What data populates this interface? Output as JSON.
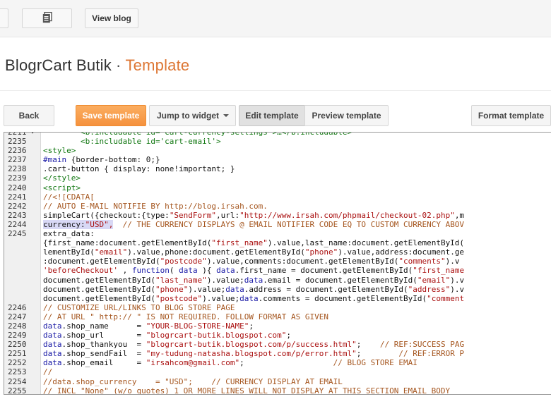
{
  "topbar": {
    "buttons": [
      {
        "name": "left-partial-button",
        "label": ""
      },
      {
        "name": "pages-button",
        "icon": "copy-document-icon",
        "label": ""
      },
      {
        "name": "view-blog-button",
        "label": "View blog"
      }
    ]
  },
  "header": {
    "blog_name": "BlogrCart Butik",
    "separator": "·",
    "section": "Template"
  },
  "actions": {
    "back": "Back",
    "save": "Save template",
    "jump": "Jump to widget",
    "edit": "Edit template",
    "preview": "Preview template",
    "format": "Format template"
  },
  "colors": {
    "accent_orange": "#dd7633",
    "save_button": "#f9a352",
    "tag_green": "#117711",
    "comment_brown": "#a5561f",
    "string_red": "#aa1111",
    "keyword_blue": "#1a1aa6"
  },
  "editor": {
    "lines": [
      {
        "n": "2211",
        "mark": "▶",
        "segs": [
          {
            "c": "c-tag",
            "t": "        <b:includable id='cart-currency-settings'>…</b:includable>"
          }
        ]
      },
      {
        "n": "2235",
        "segs": [
          {
            "c": "c-tag",
            "t": "        <b:includable id='cart-email'>"
          }
        ]
      },
      {
        "n": "2236",
        "segs": [
          {
            "c": "c-tag",
            "t": "<style>"
          }
        ]
      },
      {
        "n": "2237",
        "segs": [
          {
            "c": "c-kw",
            "t": "#main "
          },
          {
            "c": "c-plain",
            "t": "{border-bottom: 0;}"
          }
        ]
      },
      {
        "n": "2238",
        "segs": [
          {
            "c": "c-plain",
            "t": ".cart-button { display: none!important; }"
          }
        ]
      },
      {
        "n": "2239",
        "segs": [
          {
            "c": "c-tag",
            "t": "</style>"
          }
        ]
      },
      {
        "n": "2240",
        "segs": [
          {
            "c": "c-tag",
            "t": "<script>"
          }
        ]
      },
      {
        "n": "2241",
        "segs": [
          {
            "c": "c-cmt",
            "t": "//<![CDATA["
          }
        ]
      },
      {
        "n": "2242",
        "segs": [
          {
            "c": "c-cmt",
            "t": "// AUTO E-MAIL NOTIFIE BY http://blog.irsah.com."
          }
        ]
      },
      {
        "n": "2243",
        "segs": [
          {
            "c": "c-plain",
            "t": "simpleCart({checkout:{type:"
          },
          {
            "c": "c-str",
            "t": "\"SendForm\""
          },
          {
            "c": "c-plain",
            "t": ",url:"
          },
          {
            "c": "c-str",
            "t": "\"http://www.irsah.com/phpmail/checkout-02.php\""
          },
          {
            "c": "c-plain",
            "t": ",m"
          }
        ]
      },
      {
        "n": "2244",
        "segs": [
          {
            "c": "c-plain hl",
            "t": "currency:"
          },
          {
            "c": "c-str hl",
            "t": "\"USD\","
          },
          {
            "c": "c-plain",
            "t": "  "
          },
          {
            "c": "c-cmt",
            "t": "// THE CURRENCY DISPLAYS @ EMAIL NOTIFIER CODE EQ TO CUSTOM CURRENCY ABOV"
          }
        ]
      },
      {
        "n": "2245",
        "segs": [
          {
            "c": "c-plain",
            "t": "extra_data:"
          }
        ]
      },
      {
        "n": "",
        "segs": [
          {
            "c": "c-plain",
            "t": "{first_name:document.getElementById("
          },
          {
            "c": "c-str",
            "t": "\"first_name\""
          },
          {
            "c": "c-plain",
            "t": ").value,last_name:document.getElementById("
          }
        ]
      },
      {
        "n": "",
        "segs": [
          {
            "c": "c-plain",
            "t": "lementById("
          },
          {
            "c": "c-str",
            "t": "\"email\""
          },
          {
            "c": "c-plain",
            "t": ").value,phone:document.getElementById("
          },
          {
            "c": "c-str",
            "t": "\"phone\""
          },
          {
            "c": "c-plain",
            "t": ").value,address:document.ge"
          }
        ]
      },
      {
        "n": "",
        "segs": [
          {
            "c": "c-plain",
            "t": ":document.getElementById("
          },
          {
            "c": "c-str",
            "t": "\"postcode\""
          },
          {
            "c": "c-plain",
            "t": ").value,comments:document.getElementById("
          },
          {
            "c": "c-str",
            "t": "\"comments\""
          },
          {
            "c": "c-plain",
            "t": ").v"
          }
        ]
      },
      {
        "n": "",
        "segs": [
          {
            "c": "c-str",
            "t": "'beforeCheckout'"
          },
          {
            "c": "c-plain",
            "t": " , "
          },
          {
            "c": "c-kw",
            "t": "function"
          },
          {
            "c": "c-plain",
            "t": "( "
          },
          {
            "c": "c-kw",
            "t": "data"
          },
          {
            "c": "c-plain",
            "t": " ){ "
          },
          {
            "c": "c-kw",
            "t": "data"
          },
          {
            "c": "c-plain",
            "t": ".first_name = document.getElementById("
          },
          {
            "c": "c-str",
            "t": "\"first_name"
          }
        ]
      },
      {
        "n": "",
        "segs": [
          {
            "c": "c-plain",
            "t": "document.getElementById("
          },
          {
            "c": "c-str",
            "t": "\"last_name\""
          },
          {
            "c": "c-plain",
            "t": ").value;"
          },
          {
            "c": "c-kw",
            "t": "data"
          },
          {
            "c": "c-plain",
            "t": ".email = document.getElementById("
          },
          {
            "c": "c-str",
            "t": "\"email\""
          },
          {
            "c": "c-plain",
            "t": ").v"
          }
        ]
      },
      {
        "n": "",
        "segs": [
          {
            "c": "c-plain",
            "t": "document.getElementById("
          },
          {
            "c": "c-str",
            "t": "\"phone\""
          },
          {
            "c": "c-plain",
            "t": ").value;"
          },
          {
            "c": "c-kw",
            "t": "data"
          },
          {
            "c": "c-plain",
            "t": ".address = document.getElementById("
          },
          {
            "c": "c-str",
            "t": "\"address\""
          },
          {
            "c": "c-plain",
            "t": ").v"
          }
        ]
      },
      {
        "n": "",
        "segs": [
          {
            "c": "c-plain",
            "t": "document.getElementById("
          },
          {
            "c": "c-str",
            "t": "\"postcode\""
          },
          {
            "c": "c-plain",
            "t": ").value;"
          },
          {
            "c": "c-kw",
            "t": "data"
          },
          {
            "c": "c-plain",
            "t": ".comments = document.getElementById("
          },
          {
            "c": "c-str",
            "t": "\"comment"
          }
        ]
      },
      {
        "n": "2246",
        "segs": [
          {
            "c": "c-cmt",
            "t": "// CUSTOMIZE URL/LINKS TO BLOG STORE PAGE"
          }
        ]
      },
      {
        "n": "2247",
        "segs": [
          {
            "c": "c-cmt",
            "t": "// AT URL \" http:// \" IS NOT REQUIRED. FOLLOW FORMAT AS GIVEN"
          }
        ]
      },
      {
        "n": "2248",
        "segs": [
          {
            "c": "c-kw",
            "t": "data"
          },
          {
            "c": "c-plain",
            "t": ".shop_name      = "
          },
          {
            "c": "c-str",
            "t": "\"YOUR-BLOG-STORE-NAME\""
          },
          {
            "c": "c-plain",
            "t": ";"
          }
        ]
      },
      {
        "n": "2249",
        "segs": [
          {
            "c": "c-kw",
            "t": "data"
          },
          {
            "c": "c-plain",
            "t": ".shop_url       = "
          },
          {
            "c": "c-str",
            "t": "\"blogrcart-butik.blogspot.com\""
          },
          {
            "c": "c-plain",
            "t": ";"
          }
        ]
      },
      {
        "n": "2250",
        "segs": [
          {
            "c": "c-kw",
            "t": "data"
          },
          {
            "c": "c-plain",
            "t": ".shop_thankyou  = "
          },
          {
            "c": "c-str",
            "t": "\"blogrcart-butik.blogspot.com/p/success.html\""
          },
          {
            "c": "c-plain",
            "t": ";    "
          },
          {
            "c": "c-cmt",
            "t": "// REF:SUCCESS PAG"
          }
        ]
      },
      {
        "n": "2251",
        "segs": [
          {
            "c": "c-kw",
            "t": "data"
          },
          {
            "c": "c-plain",
            "t": ".shop_sendFail  = "
          },
          {
            "c": "c-str",
            "t": "\"my-tudung-natasha.blogspot.com/p/error.html\""
          },
          {
            "c": "c-plain",
            "t": ";        "
          },
          {
            "c": "c-cmt",
            "t": "// REF:ERROR P"
          }
        ]
      },
      {
        "n": "2252",
        "segs": [
          {
            "c": "c-kw",
            "t": "data"
          },
          {
            "c": "c-plain",
            "t": ".shop_email     = "
          },
          {
            "c": "c-str",
            "t": "\"irsahcom@gmail.com\""
          },
          {
            "c": "c-plain",
            "t": ";                   "
          },
          {
            "c": "c-cmt",
            "t": "// BLOG STORE EMAI"
          }
        ]
      },
      {
        "n": "2253",
        "segs": [
          {
            "c": "c-cmt",
            "t": "//"
          }
        ]
      },
      {
        "n": "2254",
        "segs": [
          {
            "c": "c-cmt",
            "t": "//data.shop_currency    = \"USD\";    // CURRENCY DISPLAY AT EMAIL"
          }
        ]
      },
      {
        "n": "2255",
        "segs": [
          {
            "c": "c-cmt",
            "t": "// INCL \"None\" (w/o quotes) 1 OR MORE LINES WILL NOT DISPLAY AT THIS SECTION EMAIL BODY"
          }
        ]
      }
    ]
  }
}
